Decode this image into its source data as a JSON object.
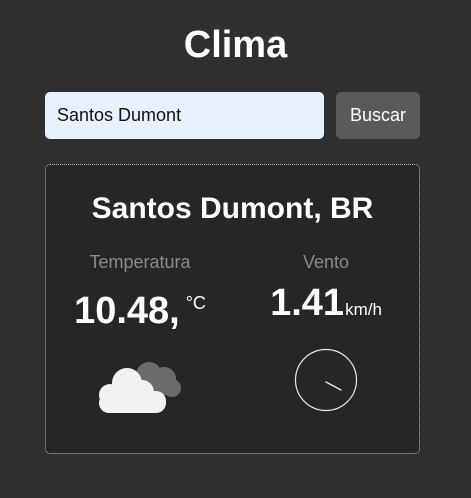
{
  "app": {
    "title": "Clima"
  },
  "search": {
    "value": "Santos Dumont",
    "button_label": "Buscar"
  },
  "weather": {
    "city": "Santos Dumont, BR",
    "temperature_label": "Temperatura",
    "temperature_value": "10.48,",
    "temperature_unit": "°C",
    "wind_label": "Vento",
    "wind_value": "1.41",
    "wind_unit": "km/h",
    "condition_icon": "cloudy-icon",
    "wind_direction_icon": "wind-direction-icon"
  }
}
